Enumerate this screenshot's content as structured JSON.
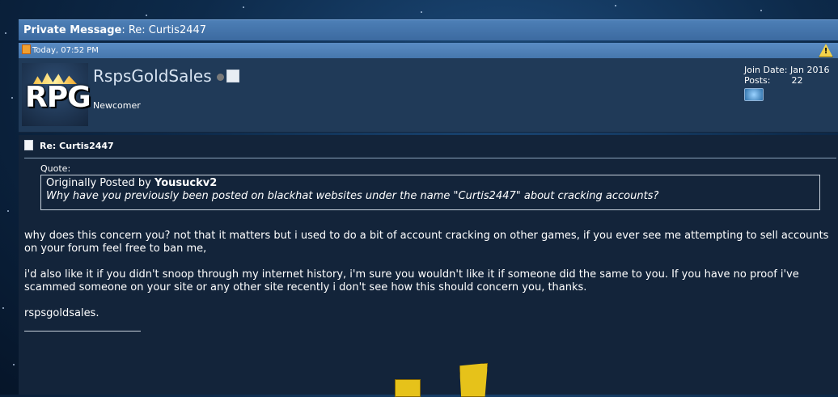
{
  "header": {
    "title_bold": "Private Message",
    "title_rest": ": Re: Curtis2447"
  },
  "post": {
    "date": "Today, 07:52 PM",
    "report_icon": "warning-triangle-icon"
  },
  "user": {
    "avatar_text": "RPG",
    "name": "RspsGoldSales",
    "title": "Newcomer",
    "join_label": "Join Date:",
    "join_value": "Jan 2016",
    "posts_label": "Posts:",
    "posts_value": "22"
  },
  "message": {
    "subject": "Re: Curtis2447",
    "quote_label": "Quote:",
    "quote_intro": "Originally Posted by ",
    "quote_author": "Yousuckv2",
    "quote_text": "Why have you previously been posted on blackhat websites under the name \"Curtis2447\" about cracking accounts?",
    "paragraph1": "why does this concern you? not that it matters but i used to do a bit of account cracking on other games, if you ever see me attempting to sell accounts on your forum feel free to ban me,",
    "paragraph2": "i'd also like it if you didn't snoop through my internet history, i'm sure you wouldn't like it if someone did the same to you. If you have no proof i've scammed someone on your site or any other site recently i don't see how this should concern you, thanks.",
    "signoff": "rspsgoldsales."
  }
}
